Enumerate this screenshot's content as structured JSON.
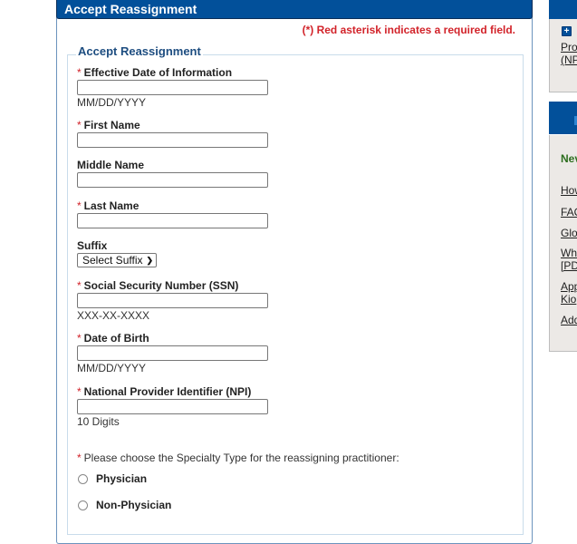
{
  "panel": {
    "title": "Accept Reassignment",
    "required_note": "(*) Red asterisk indicates a required field.",
    "legend": "Accept Reassignment"
  },
  "form": {
    "required_marker": "*",
    "effective_date": {
      "label": "Effective Date of Information",
      "value": "",
      "hint": "MM/DD/YYYY",
      "required": true
    },
    "first_name": {
      "label": "First Name",
      "value": "",
      "required": true
    },
    "middle_name": {
      "label": "Middle Name",
      "value": "",
      "required": false
    },
    "last_name": {
      "label": "Last Name",
      "value": "",
      "required": true
    },
    "suffix": {
      "label": "Suffix",
      "selected": "Select Suffix",
      "required": false
    },
    "ssn": {
      "label": "Social Security Number (SSN)",
      "value": "",
      "hint": "XXX-XX-XXXX",
      "required": true
    },
    "dob": {
      "label": "Date of Birth",
      "value": "",
      "hint": "MM/DD/YYYY",
      "required": true
    },
    "npi": {
      "label": "National Provider Identifier (NPI)",
      "value": "",
      "hint": "10 Digits",
      "required": true
    },
    "specialty": {
      "question": "Please choose the Specialty Type for the reassigning practitioner:",
      "options": [
        {
          "label": "Physician",
          "checked": false
        },
        {
          "label": "Non-Physician",
          "checked": false
        }
      ]
    }
  },
  "sidebar": {
    "box1": {
      "link_line1": "Pro",
      "link_line2": "(NP"
    },
    "box2": {
      "new_label": "Nev",
      "links": [
        {
          "line1": "How"
        },
        {
          "line1": "FAQ"
        },
        {
          "line1": "Glo"
        },
        {
          "line1": "Whe",
          "line2": "[PD"
        },
        {
          "line1": "App",
          "line2": "Kio"
        },
        {
          "line1": "Add"
        }
      ]
    }
  },
  "colors": {
    "header_blue": "#02509a",
    "required_red": "#d2232a",
    "legend_blue": "#1d4d80",
    "new_green": "#2c6e1e"
  }
}
